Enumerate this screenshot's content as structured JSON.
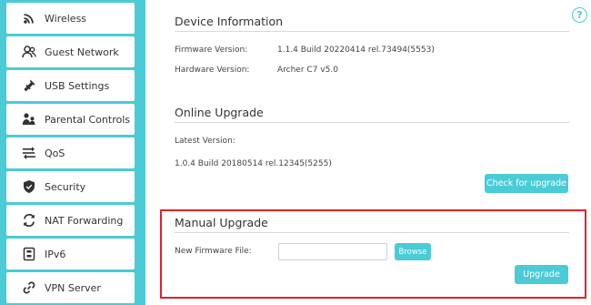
{
  "sidebar": {
    "items": [
      {
        "label": "Wireless",
        "icon": "wifi-icon"
      },
      {
        "label": "Guest Network",
        "icon": "guest-users-icon"
      },
      {
        "label": "USB Settings",
        "icon": "usb-icon"
      },
      {
        "label": "Parental Controls",
        "icon": "parental-icon"
      },
      {
        "label": "QoS",
        "icon": "qos-icon"
      },
      {
        "label": "Security",
        "icon": "shield-icon"
      },
      {
        "label": "NAT Forwarding",
        "icon": "nat-icon"
      },
      {
        "label": "IPv6",
        "icon": "ipv6-icon"
      },
      {
        "label": "VPN Server",
        "icon": "link-icon"
      }
    ]
  },
  "device_info": {
    "title": "Device Information",
    "firmware_label": "Firmware Version:",
    "firmware_value": "1.1.4 Build 20220414 rel.73494(5553)",
    "hardware_label": "Hardware Version:",
    "hardware_value": "Archer C7 v5.0"
  },
  "online_upgrade": {
    "title": "Online Upgrade",
    "latest_label": "Latest Version:",
    "latest_value": "1.0.4 Build 20180514 rel.12345(5255)",
    "check_button": "Check for upgrade"
  },
  "manual_upgrade": {
    "title": "Manual Upgrade",
    "file_label": "New Firmware File:",
    "file_value": "",
    "browse_button": "Browse",
    "upgrade_button": "Upgrade"
  },
  "help": {
    "glyph": "?"
  },
  "colors": {
    "accent": "#4acbd6",
    "highlight": "#e0232b"
  }
}
